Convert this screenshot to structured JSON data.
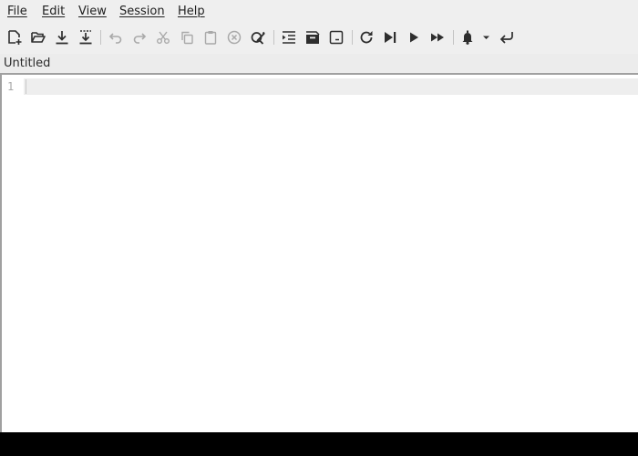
{
  "menubar": {
    "items": [
      {
        "label": "File",
        "mnemonic": "F"
      },
      {
        "label": "Edit",
        "mnemonic": "E"
      },
      {
        "label": "View",
        "mnemonic": "V"
      },
      {
        "label": "Session",
        "mnemonic": "S"
      },
      {
        "label": "Help",
        "mnemonic": "H"
      }
    ]
  },
  "toolbar": {
    "buttons": [
      {
        "icon": "new-file-icon",
        "enabled": true
      },
      {
        "icon": "open-folder-icon",
        "enabled": true
      },
      {
        "icon": "save-icon",
        "enabled": true
      },
      {
        "icon": "save-as-icon",
        "enabled": true
      },
      {
        "icon": "undo-icon",
        "enabled": false
      },
      {
        "icon": "redo-icon",
        "enabled": false
      },
      {
        "icon": "cut-icon",
        "enabled": false
      },
      {
        "icon": "copy-icon",
        "enabled": false
      },
      {
        "icon": "paste-icon",
        "enabled": false
      },
      {
        "icon": "clear-icon",
        "enabled": false
      },
      {
        "icon": "find-replace-icon",
        "enabled": true
      },
      {
        "icon": "indent-icon",
        "enabled": true
      },
      {
        "icon": "archive-icon",
        "enabled": true
      },
      {
        "icon": "terminal-icon",
        "enabled": true
      },
      {
        "icon": "reload-icon",
        "enabled": true
      },
      {
        "icon": "step-forward-icon",
        "enabled": true
      },
      {
        "icon": "play-icon",
        "enabled": true
      },
      {
        "icon": "fast-forward-icon",
        "enabled": true
      },
      {
        "icon": "bell-icon",
        "enabled": true
      },
      {
        "icon": "bell-dropdown-icon",
        "enabled": true
      },
      {
        "icon": "return-icon",
        "enabled": true
      }
    ]
  },
  "tab": {
    "title": "Untitled"
  },
  "editor": {
    "line_numbers": [
      "1"
    ],
    "content": ""
  },
  "colors": {
    "window_bg": "#efefef",
    "editor_bg": "#ffffff",
    "current_line": "#eeeeee",
    "icon_enabled": "#2e2e2e",
    "icon_disabled": "#a9a9a9"
  }
}
